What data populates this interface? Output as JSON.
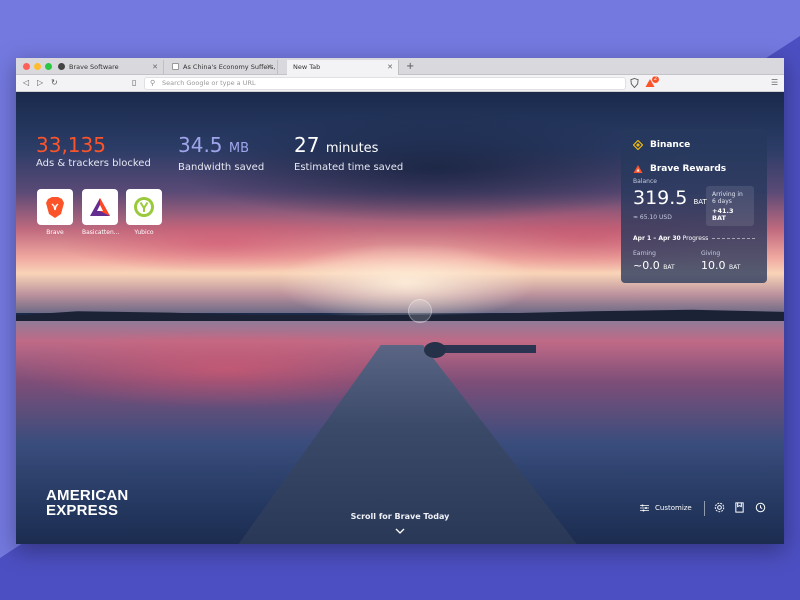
{
  "browser": {
    "tabs": [
      {
        "title": "Brave Software"
      },
      {
        "title": "As China's Economy Suffers, Xi F..."
      },
      {
        "title": "New Tab"
      }
    ],
    "new_tab_symbol": "+",
    "url_placeholder": "Search Google or type a URL",
    "notification_count": "2",
    "traffic_lights": [
      "#fe5f57",
      "#febc2e",
      "#28c840"
    ]
  },
  "stats": {
    "ads_blocked": {
      "value": "33,135",
      "label": "Ads & trackers blocked",
      "color": "#fb542b"
    },
    "bandwidth": {
      "value": "34.5",
      "unit": "MB",
      "label": "Bandwidth saved",
      "color": "#a0a5eb"
    },
    "time": {
      "value": "27",
      "unit": "minutes",
      "label": "Estimated time saved",
      "color": "#ffffff"
    }
  },
  "top_sites": [
    {
      "name": "Brave",
      "icon": "brave-lion-icon"
    },
    {
      "name": "Basicatten...",
      "icon": "bat-triangle-icon"
    },
    {
      "name": "Yubico",
      "icon": "yubico-icon"
    }
  ],
  "widget": {
    "binance_title": "Binance",
    "rewards_title": "Brave Rewards",
    "balance_label": "Balance",
    "balance_value": "319.5",
    "balance_unit": "BAT",
    "balance_usd": "≈ 65.10 USD",
    "arriving_label": "Arriving in 6 days",
    "arriving_amount": "+41.3 BAT",
    "period_range": "Apr 1 – Apr 30",
    "period_label": "Progress",
    "earning_label": "Earning",
    "earning_value": "~0.0",
    "earning_unit": "BAT",
    "giving_label": "Giving",
    "giving_value": "10.0",
    "giving_unit": "BAT"
  },
  "sponsor": {
    "line1": "AMERICAN",
    "line2": "EXPRESS"
  },
  "bottom": {
    "scroll_label": "Scroll for Brave Today",
    "customize_label": "Customize",
    "icons": [
      "settings-icon",
      "bookmarks-icon",
      "history-icon"
    ]
  }
}
